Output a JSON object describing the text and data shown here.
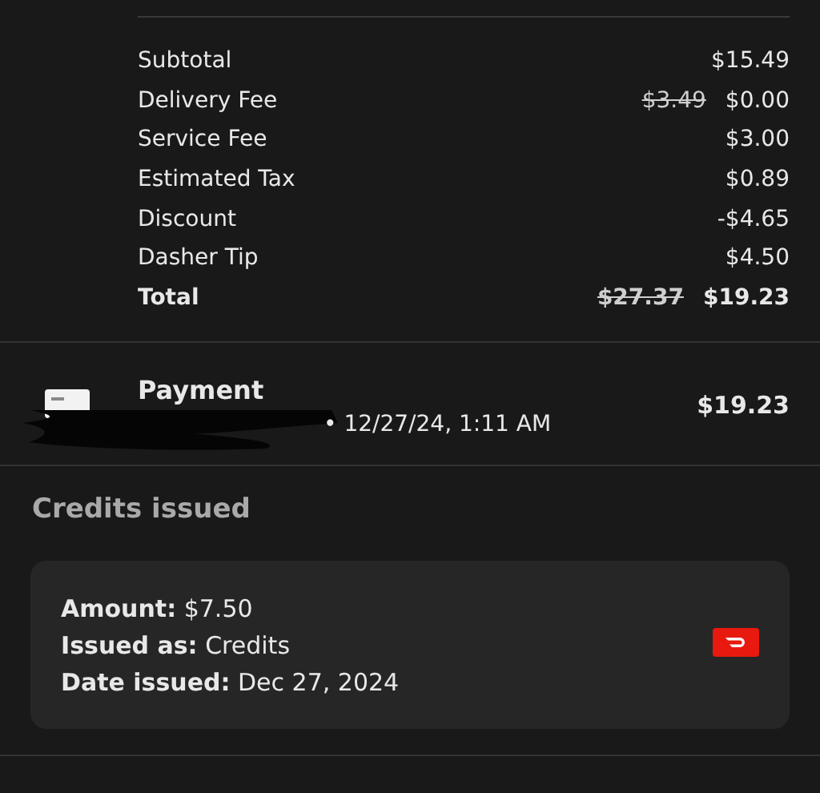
{
  "summary": {
    "lines": [
      {
        "kind": "line",
        "label": "Subtotal",
        "value": "$15.49"
      },
      {
        "kind": "line",
        "label": "Delivery Fee",
        "original": "$3.49",
        "value": "$0.00"
      },
      {
        "kind": "line",
        "label": "Service Fee",
        "value": "$3.00"
      },
      {
        "kind": "line",
        "label": "Estimated Tax",
        "value": "$0.89"
      },
      {
        "kind": "line",
        "label": "Discount",
        "value": "-$4.65"
      },
      {
        "kind": "line",
        "label": "Dasher Tip",
        "value": "$4.50"
      },
      {
        "kind": "total",
        "label": "Total",
        "original": "$27.37",
        "value": "$19.23"
      }
    ]
  },
  "payment": {
    "title": "Payment",
    "detail": "• 12/27/24, 1:11 AM",
    "amount": "$19.23"
  },
  "credits": {
    "heading": "Credits issued",
    "fields": [
      {
        "label": "Amount:",
        "value": "$7.50"
      },
      {
        "label": "Issued as:",
        "value": "Credits"
      },
      {
        "label": "Date issued:",
        "value": "Dec 27, 2024"
      }
    ]
  }
}
